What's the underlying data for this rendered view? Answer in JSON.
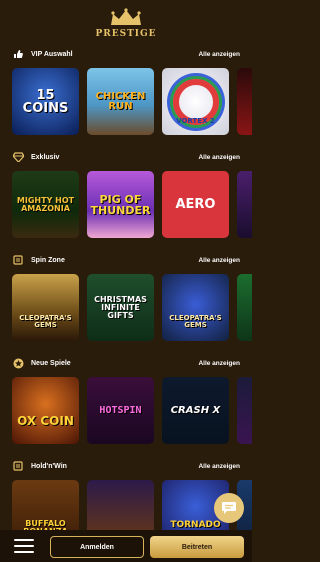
{
  "header": {
    "logo_text": "PRESTIGE"
  },
  "sections": [
    {
      "title": "VIP Auswahl",
      "all_label": "Alle anzeigen",
      "icon": "thumbs-up-icon",
      "tiles": [
        "15 COINS",
        "CHICKEN RUN",
        "VORTEX 2",
        ""
      ]
    },
    {
      "title": "Exklusiv",
      "all_label": "Alle anzeigen",
      "icon": "diamond-icon",
      "tiles": [
        "MIGHTY HOT AMAZONIA",
        "PIG OF THUNDER",
        "AERO",
        ""
      ]
    },
    {
      "title": "Spin Zone",
      "all_label": "Alle anzeigen",
      "icon": "slot-icon",
      "tiles": [
        "CLEOPATRA'S GEMS",
        "CHRISTMAS INFINITE GIFTS",
        "CLEOPATRA'S GEMS",
        ""
      ]
    },
    {
      "title": "Neue Spiele",
      "all_label": "Alle anzeigen",
      "icon": "star-icon",
      "tiles": [
        "OX COIN",
        "HOTSPIN",
        "CRASH X",
        ""
      ]
    },
    {
      "title": "Hold'n'Win",
      "all_label": "Alle anzeigen",
      "icon": "slot-icon",
      "tiles": [
        "BUFFALO BONANZA",
        "",
        "TORNADO",
        ""
      ]
    }
  ],
  "bottom_bar": {
    "login_label": "Anmelden",
    "join_label": "Beitreten"
  },
  "colors": {
    "accent": "#d6b35a",
    "background": "#2a1c0b"
  }
}
